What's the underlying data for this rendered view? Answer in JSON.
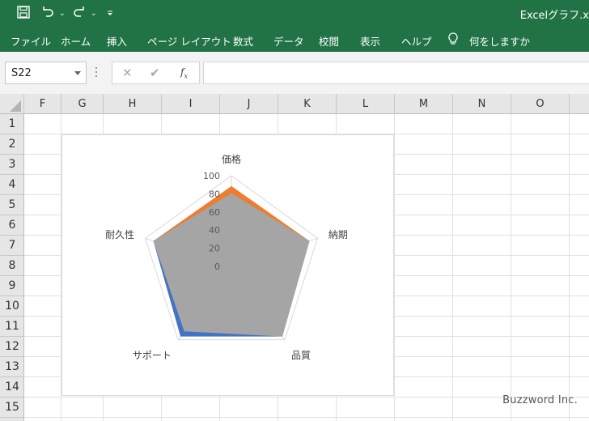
{
  "window": {
    "title": "Excelグラフ.x"
  },
  "ribbon": {
    "tabs": [
      "ファイル",
      "ホーム",
      "挿入",
      "ページ レイアウト",
      "数式",
      "データ",
      "校閲",
      "表示",
      "ヘルプ"
    ],
    "tell_me": "何をしますか"
  },
  "formula_bar": {
    "name_box": "S22",
    "cancel": "✕",
    "enter": "✔",
    "fx": "fx",
    "value": ""
  },
  "grid": {
    "columns": [
      "F",
      "G",
      "H",
      "I",
      "J",
      "K",
      "L",
      "M",
      "N",
      "O"
    ],
    "rows": [
      "1",
      "2",
      "3",
      "4",
      "5",
      "6",
      "7",
      "8",
      "9",
      "10",
      "11",
      "12",
      "13",
      "14",
      "15"
    ]
  },
  "chart_data": {
    "type": "radar",
    "categories": [
      "価格",
      "納期",
      "品質",
      "サポート",
      "耐久性"
    ],
    "r_ticks": [
      "100",
      "80",
      "60",
      "40",
      "20",
      "0"
    ],
    "rlim": [
      0,
      100
    ],
    "series": [
      {
        "color": "#4472c4",
        "values": [
          80,
          90,
          95,
          95,
          90
        ]
      },
      {
        "color": "#ed7d31",
        "values": [
          88,
          90,
          95,
          85,
          90
        ]
      },
      {
        "color": "#a5a5a5",
        "values": [
          80,
          90,
          95,
          88,
          90
        ]
      }
    ],
    "grid_color": "#d9d9d9"
  },
  "watermark": "Buzzword Inc."
}
